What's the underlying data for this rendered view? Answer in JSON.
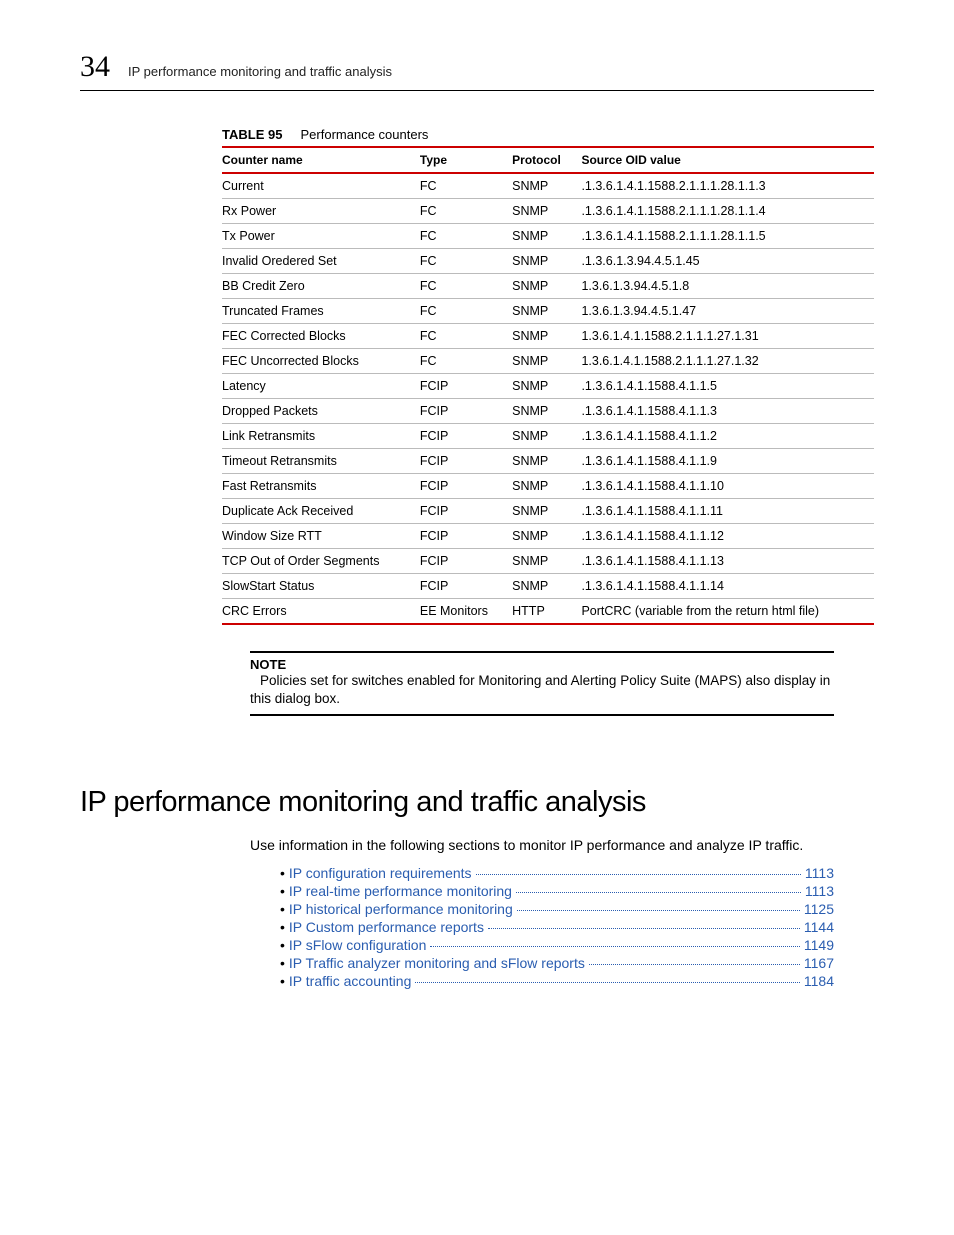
{
  "chapter_number": "34",
  "running_title": "IP performance monitoring and traffic analysis",
  "table": {
    "label": "TABLE 95",
    "caption": "Performance counters",
    "headers": [
      "Counter name",
      "Type",
      "Protocol",
      "Source OID value"
    ],
    "rows": [
      [
        "Current",
        "FC",
        "SNMP",
        ".1.3.6.1.4.1.1588.2.1.1.1.28.1.1.3"
      ],
      [
        "Rx Power",
        "FC",
        "SNMP",
        ".1.3.6.1.4.1.1588.2.1.1.1.28.1.1.4"
      ],
      [
        "Tx Power",
        "FC",
        "SNMP",
        ".1.3.6.1.4.1.1588.2.1.1.1.28.1.1.5"
      ],
      [
        "Invalid Oredered Set",
        "FC",
        "SNMP",
        ".1.3.6.1.3.94.4.5.1.45"
      ],
      [
        "BB Credit Zero",
        "FC",
        "SNMP",
        "1.3.6.1.3.94.4.5.1.8"
      ],
      [
        "Truncated Frames",
        "FC",
        "SNMP",
        "1.3.6.1.3.94.4.5.1.47"
      ],
      [
        "FEC Corrected Blocks",
        "FC",
        "SNMP",
        "1.3.6.1.4.1.1588.2.1.1.1.27.1.31"
      ],
      [
        "FEC Uncorrected Blocks",
        "FC",
        "SNMP",
        "1.3.6.1.4.1.1588.2.1.1.1.27.1.32"
      ],
      [
        "Latency",
        "FCIP",
        "SNMP",
        ".1.3.6.1.4.1.1588.4.1.1.5"
      ],
      [
        "Dropped Packets",
        "FCIP",
        "SNMP",
        ".1.3.6.1.4.1.1588.4.1.1.3"
      ],
      [
        "Link Retransmits",
        "FCIP",
        "SNMP",
        ".1.3.6.1.4.1.1588.4.1.1.2"
      ],
      [
        "Timeout Retransmits",
        "FCIP",
        "SNMP",
        ".1.3.6.1.4.1.1588.4.1.1.9"
      ],
      [
        "Fast Retransmits",
        "FCIP",
        "SNMP",
        ".1.3.6.1.4.1.1588.4.1.1.10"
      ],
      [
        "Duplicate Ack Received",
        "FCIP",
        "SNMP",
        ".1.3.6.1.4.1.1588.4.1.1.11"
      ],
      [
        "Window Size RTT",
        "FCIP",
        "SNMP",
        ".1.3.6.1.4.1.1588.4.1.1.12"
      ],
      [
        "TCP Out of Order Segments",
        "FCIP",
        "SNMP",
        ".1.3.6.1.4.1.1588.4.1.1.13"
      ],
      [
        "SlowStart Status",
        "FCIP",
        "SNMP",
        ".1.3.6.1.4.1.1588.4.1.1.14"
      ],
      [
        "CRC Errors",
        "EE Monitors",
        "HTTP",
        "PortCRC (variable from the return html file)"
      ]
    ]
  },
  "note": {
    "heading": "NOTE",
    "body": "Policies set for switches enabled for Monitoring and Alerting Policy Suite (MAPS) also display in this dialog box."
  },
  "section_heading": "IP performance monitoring and traffic analysis",
  "intro_text": "Use information in the following sections to monitor IP performance and analyze IP traffic.",
  "toc": [
    {
      "label": "IP configuration requirements",
      "page": "1113"
    },
    {
      "label": "IP real-time performance monitoring",
      "page": "1113"
    },
    {
      "label": "IP historical performance monitoring",
      "page": "1125"
    },
    {
      "label": "IP Custom performance reports",
      "page": "1144"
    },
    {
      "label": "IP sFlow configuration",
      "page": "1149"
    },
    {
      "label": "IP Traffic analyzer monitoring and sFlow reports",
      "page": "1167"
    },
    {
      "label": "IP traffic accounting",
      "page": "1184"
    }
  ]
}
